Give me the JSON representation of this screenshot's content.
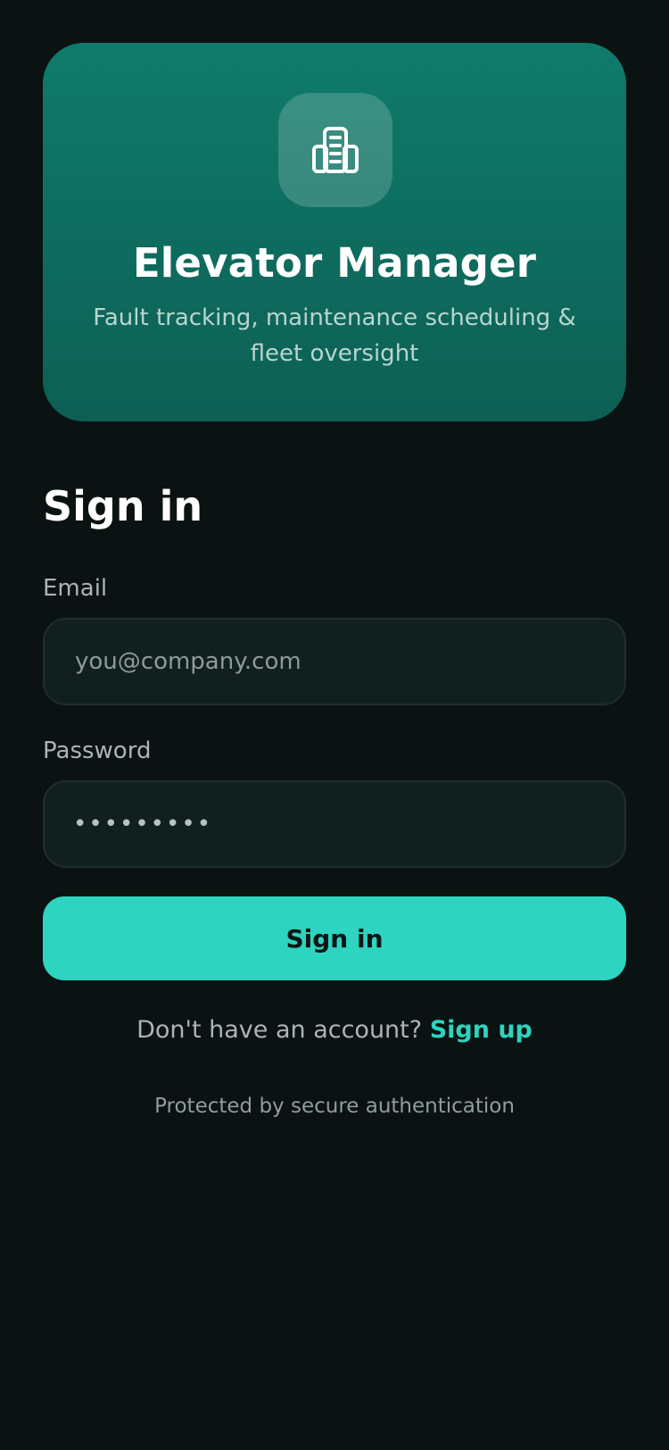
{
  "hero": {
    "icon": "building-icon",
    "title": "Elevator Manager",
    "subtitle": "Fault tracking, maintenance scheduling & fleet oversight"
  },
  "form": {
    "heading": "Sign in",
    "email": {
      "label": "Email",
      "placeholder": "you@company.com",
      "value": ""
    },
    "password": {
      "label": "Password",
      "value": "•••••••••"
    },
    "submit_label": "Sign in"
  },
  "signup": {
    "prompt": "Don't have an account?",
    "link": "Sign up"
  },
  "footer": {
    "note": "Protected by secure authentication"
  },
  "colors": {
    "accent": "#2dd4bf",
    "hero_top": "#0f7b6b",
    "hero_bottom": "#0d5f54",
    "background": "#0a1212"
  }
}
